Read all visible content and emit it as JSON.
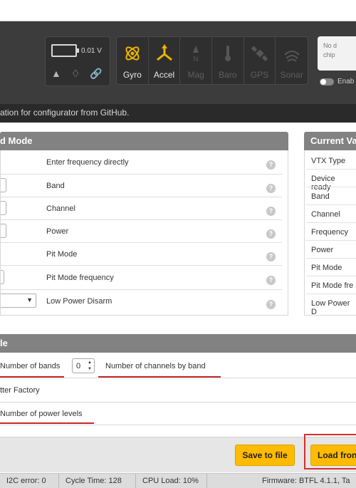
{
  "battery": {
    "voltage": "0.01 V"
  },
  "sensors": [
    {
      "label": "Gyro",
      "state": "on"
    },
    {
      "label": "Accel",
      "state": "on"
    },
    {
      "label": "Mag",
      "state": "off"
    },
    {
      "label": "Baro",
      "state": "off"
    },
    {
      "label": "GPS",
      "state": "off"
    },
    {
      "label": "Sonar",
      "state": "off"
    }
  ],
  "port": {
    "line1": "No d",
    "line2": "chip"
  },
  "enable_label": "Enab",
  "notice": "ation for configurator from GitHub.",
  "vtx_panel": {
    "title": "d Mode",
    "rows": [
      {
        "label": "Enter frequency directly"
      },
      {
        "label": "Band"
      },
      {
        "label": "Channel"
      },
      {
        "label": "Power"
      },
      {
        "label": "Pit Mode"
      },
      {
        "label": "Pit Mode frequency"
      },
      {
        "label": "Low Power Disarm"
      }
    ],
    "help": "?"
  },
  "current_panel": {
    "title": "Current Va",
    "rows": [
      "VTX Type",
      "Device ready",
      "Band",
      "Channel",
      "Frequency",
      "Power",
      "Pit Mode",
      "Pit Mode fre",
      "Low Power D"
    ]
  },
  "table_panel": {
    "title": "le",
    "bands_label": "Number of bands",
    "bands_value": "0",
    "channels_label": "Number of channels by band",
    "factory_label": "tter Factory",
    "power_levels_label": "Number of power levels"
  },
  "buttons": {
    "save_file": "Save to file",
    "load_from": "Load fron"
  },
  "statusbar": {
    "i2c": "I2C error: 0",
    "cycle": "Cycle Time: 128",
    "cpu": "CPU Load: 10%",
    "firmware": "Firmware: BTFL 4.1.1, Ta"
  },
  "colors": {
    "accent": "#ffbb00",
    "highlight": "#c62828",
    "header": "#3c3c3c"
  }
}
